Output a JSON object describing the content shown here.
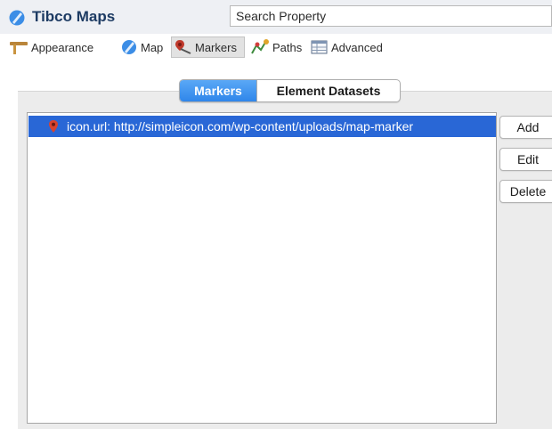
{
  "header": {
    "app_title": "Tibco Maps",
    "logo_icon": "map-globe-icon",
    "search_placeholder": "Search Property"
  },
  "toolbar": {
    "items": [
      {
        "label": "Appearance",
        "icon": "pen-icon"
      },
      {
        "label": "Map",
        "icon": "map-globe-icon"
      },
      {
        "label": "Markers",
        "icon": "marker-icon",
        "selected": true
      },
      {
        "label": "Paths",
        "icon": "paths-icon"
      },
      {
        "label": "Advanced",
        "icon": "table-icon"
      }
    ]
  },
  "tabs": {
    "markers": "Markers",
    "element_datasets": "Element Datasets",
    "active": "Markers"
  },
  "marker_list": {
    "items": [
      {
        "text": "icon.url: http://simpleicon.com/wp-content/uploads/map-marker",
        "icon": "marker-pin-icon",
        "selected": true
      }
    ]
  },
  "buttons": {
    "add": "Add",
    "edit": "Edit",
    "delete": "Delete"
  },
  "colors": {
    "selection": "#2967d6",
    "tab_active": "#3a8ff0",
    "header_bg": "#eef0f4",
    "panel_bg": "#ececec"
  }
}
